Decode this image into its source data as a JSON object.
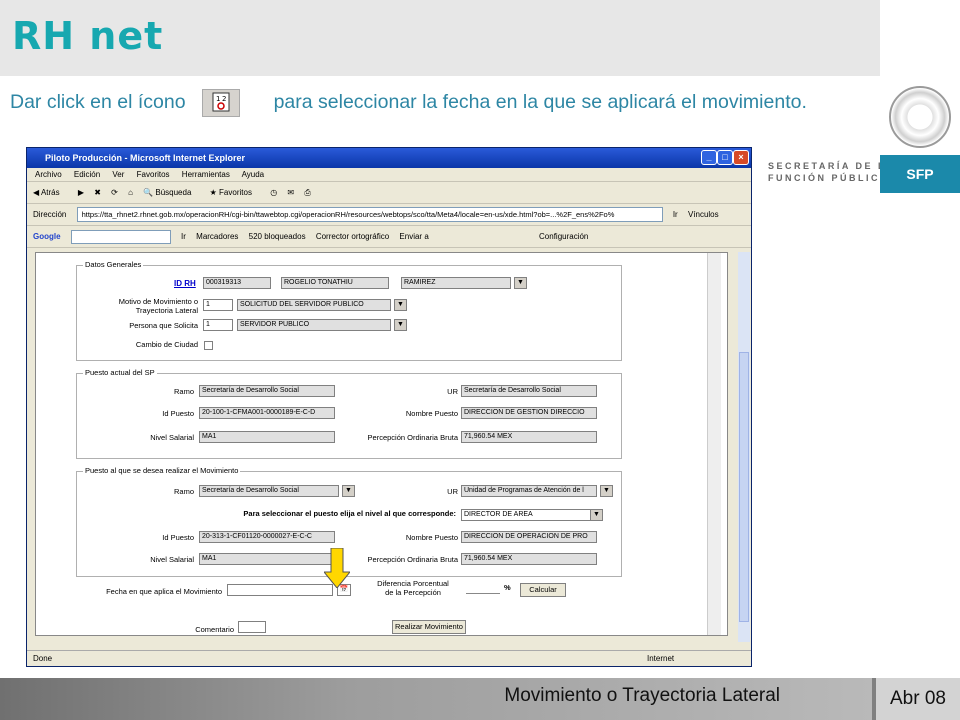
{
  "header": {
    "title": "RH net"
  },
  "instruction": {
    "before": "Dar click en el ícono",
    "after": "para seleccionar la fecha en la que se aplicará el movimiento."
  },
  "brand": {
    "secretaria_line1": "SECRETARÍA DE LA",
    "secretaria_line2": "FUNCIÓN PÚBLICA",
    "sfp": "SFP"
  },
  "footer": {
    "title": "Movimiento o Trayectoria Lateral",
    "date": "Abr 08"
  },
  "browser": {
    "title": "Piloto Producción - Microsoft Internet Explorer",
    "menu": [
      "Archivo",
      "Edición",
      "Ver",
      "Favoritos",
      "Herramientas",
      "Ayuda"
    ],
    "toolbar": {
      "back": "Atrás",
      "search": "Búsqueda",
      "favorites": "Favoritos"
    },
    "address": {
      "label": "Dirección",
      "url": "https://tta_rhnet2.rhnet.gob.mx/operacionRH/cgi-bin/ttawebtop.cgi/operacionRH/resources/webtops/sco/tta/Meta4/locale=en-us/xde.html?ob=...%2F_ens%2Fo%",
      "go": "Ir",
      "links": "Vínculos"
    },
    "google": {
      "label": "Google",
      "go": "Ir",
      "bookmarks": "Marcadores",
      "blocked": "520 bloqueados",
      "spell": "Corrector ortográfico",
      "send": "Enviar a",
      "settings": "Configuración"
    },
    "status": {
      "left": "Done",
      "zone": "Internet"
    }
  },
  "form": {
    "datos": {
      "legend": "Datos Generales",
      "id_label": "ID RH",
      "id": "000319313",
      "name": "ROGELIO TONATHIU",
      "surname": "RAMIREZ",
      "motivo_label1": "Motivo  de Movimiento o",
      "motivo_label2": "Trayectoria Lateral",
      "motivo_code": "1",
      "motivo": "SOLICITUD DEL SERVIDOR PUBLICO",
      "persona_label": "Persona que Solicita",
      "persona_code": "1",
      "persona": "SERVIDOR PUBLICO",
      "ciudad_label": "Cambio de Ciudad"
    },
    "actual": {
      "legend": "Puesto actual del SP",
      "ramo_label": "Ramo",
      "ramo": "Secretaría de Desarrollo Social",
      "ur_label": "UR",
      "ur": "Secretaría de Desarrollo Social",
      "idp_label": "Id Puesto",
      "idp": "20-100-1-CFMA001-0000189-E-C-D",
      "nombre_label": "Nombre Puesto",
      "nombre": "DIRECCION DE GESTION DIRECCIO",
      "nivel_label": "Nivel Salarial",
      "nivel": "MA1",
      "perc_label": "Percepción Ordinaria Bruta",
      "perc": "71,960.54 MEX"
    },
    "nuevo": {
      "legend": "Puesto al que se desea realizar el Movimiento",
      "ramo_label": "Ramo",
      "ramo": "Secretaría de Desarrollo Social",
      "ur_label": "UR",
      "ur": "Unidad de Programas de Atención de l",
      "nivel_prompt": "Para seleccionar el puesto elija el nivel al que corresponde:",
      "nivel_sel": "DIRECTOR DE AREA",
      "idp_label": "Id Puesto",
      "idp": "20-313-1-CF01120-0000027-E-C-C",
      "nombre_label": "Nombre Puesto",
      "nombre": "DIRECCION DE OPERACION DE PRO",
      "nivel_label": "Nivel Salarial",
      "nivel": "MA1",
      "perc_label": "Percepción Ordinaria Bruta",
      "perc": "71,960.54 MEX"
    },
    "fecha_label": "Fecha en que aplica el Movimiento",
    "dif_label1": "Diferencia Porcentual",
    "dif_label2": "de la Percepción",
    "pct": "%",
    "calc": "Calcular",
    "comentario": "Comentario",
    "realizar": "Realizar Movimiento"
  }
}
